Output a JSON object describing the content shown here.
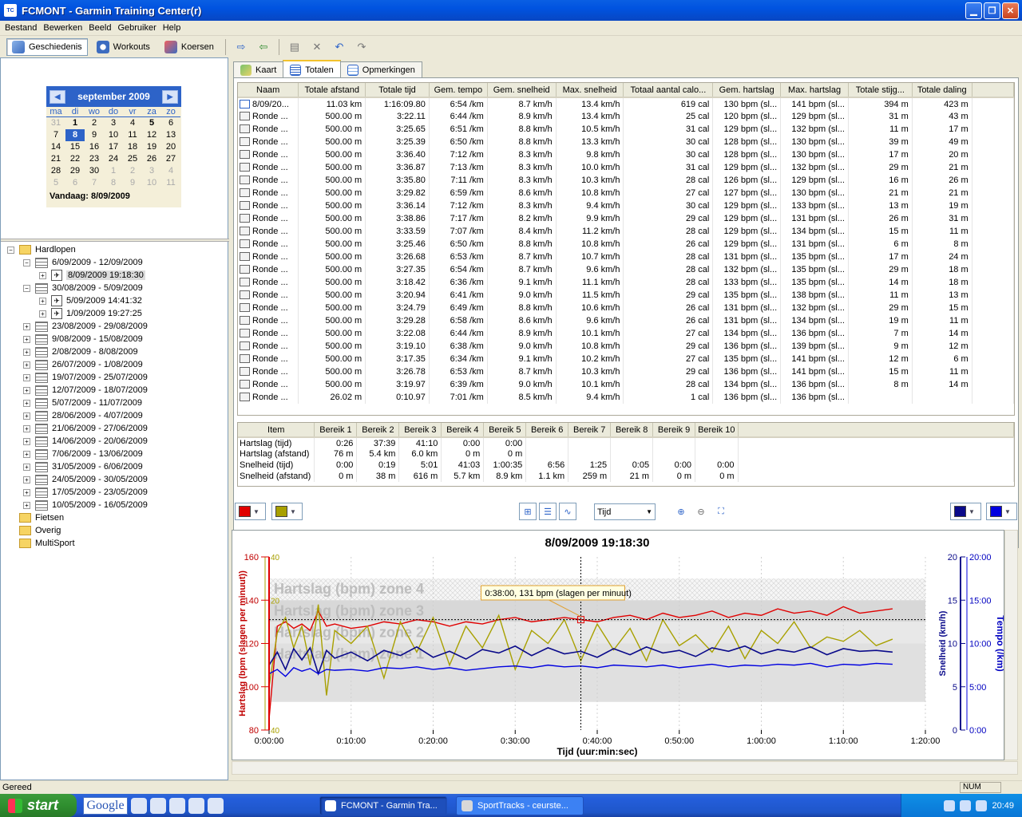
{
  "window": {
    "title": "FCMONT - Garmin Training Center(r)",
    "icon_text": "TC"
  },
  "menu": [
    "Bestand",
    "Bewerken",
    "Beeld",
    "Gebruiker",
    "Help"
  ],
  "toolbar": {
    "history": "Geschiedenis",
    "workouts": "Workouts",
    "courses": "Koersen"
  },
  "calendar": {
    "month": "september 2009",
    "dow": [
      "ma",
      "di",
      "wo",
      "do",
      "vr",
      "za",
      "zo"
    ],
    "rows": [
      [
        "31",
        "1",
        "2",
        "3",
        "4",
        "5",
        "6"
      ],
      [
        "7",
        "8",
        "9",
        "10",
        "11",
        "12",
        "13"
      ],
      [
        "14",
        "15",
        "16",
        "17",
        "18",
        "19",
        "20"
      ],
      [
        "21",
        "22",
        "23",
        "24",
        "25",
        "26",
        "27"
      ],
      [
        "28",
        "29",
        "30",
        "1",
        "2",
        "3",
        "4"
      ],
      [
        "5",
        "6",
        "7",
        "8",
        "9",
        "10",
        "11"
      ]
    ],
    "selected": "8",
    "today": "Vandaag: 8/09/2009"
  },
  "tree": {
    "root": "Hardlopen",
    "weeks_open": [
      {
        "label": "6/09/2009 - 12/09/2009",
        "acts": [
          "8/09/2009 19:18:30"
        ]
      },
      {
        "label": "30/08/2009 - 5/09/2009",
        "acts": [
          "5/09/2009 14:41:32",
          "1/09/2009 19:27:25"
        ]
      }
    ],
    "weeks_closed": [
      "23/08/2009 - 29/08/2009",
      "9/08/2009 - 15/08/2009",
      "2/08/2009 - 8/08/2009",
      "26/07/2009 - 1/08/2009",
      "19/07/2009 - 25/07/2009",
      "12/07/2009 - 18/07/2009",
      "5/07/2009 - 11/07/2009",
      "28/06/2009 - 4/07/2009",
      "21/06/2009 - 27/06/2009",
      "14/06/2009 - 20/06/2009",
      "7/06/2009 - 13/06/2009",
      "31/05/2009 - 6/06/2009",
      "24/05/2009 - 30/05/2009",
      "17/05/2009 - 23/05/2009",
      "10/05/2009 - 16/05/2009"
    ],
    "folders": [
      "Fietsen",
      "Overig",
      "MultiSport"
    ]
  },
  "tabs": [
    "Kaart",
    "Totalen",
    "Opmerkingen"
  ],
  "laps_table": {
    "headers": [
      "Naam",
      "Totale afstand",
      "Totale tijd",
      "Gem. tempo",
      "Gem. snelheid",
      "Max. snelheid",
      "Totaal aantal calo...",
      "Gem. hartslag",
      "Max. hartslag",
      "Totale stijg...",
      "Totale daling"
    ],
    "rows": [
      [
        "8/09/20...",
        "11.03 km",
        "1:16:09.80",
        "6:54 /km",
        "8.7 km/h",
        "13.4 km/h",
        "619 cal",
        "130 bpm (sl...",
        "141 bpm (sl...",
        "394 m",
        "423 m"
      ],
      [
        "Ronde ...",
        "500.00 m",
        "3:22.11",
        "6:44 /km",
        "8.9 km/h",
        "13.4 km/h",
        "25 cal",
        "120 bpm (sl...",
        "129 bpm (sl...",
        "31 m",
        "43 m"
      ],
      [
        "Ronde ...",
        "500.00 m",
        "3:25.65",
        "6:51 /km",
        "8.8 km/h",
        "10.5 km/h",
        "31 cal",
        "129 bpm (sl...",
        "132 bpm (sl...",
        "11 m",
        "17 m"
      ],
      [
        "Ronde ...",
        "500.00 m",
        "3:25.39",
        "6:50 /km",
        "8.8 km/h",
        "13.3 km/h",
        "30 cal",
        "128 bpm (sl...",
        "130 bpm (sl...",
        "39 m",
        "49 m"
      ],
      [
        "Ronde ...",
        "500.00 m",
        "3:36.40",
        "7:12 /km",
        "8.3 km/h",
        "9.8 km/h",
        "30 cal",
        "128 bpm (sl...",
        "130 bpm (sl...",
        "17 m",
        "20 m"
      ],
      [
        "Ronde ...",
        "500.00 m",
        "3:36.87",
        "7:13 /km",
        "8.3 km/h",
        "10.0 km/h",
        "31 cal",
        "129 bpm (sl...",
        "132 bpm (sl...",
        "29 m",
        "21 m"
      ],
      [
        "Ronde ...",
        "500.00 m",
        "3:35.80",
        "7:11 /km",
        "8.3 km/h",
        "10.3 km/h",
        "28 cal",
        "126 bpm (sl...",
        "129 bpm (sl...",
        "16 m",
        "26 m"
      ],
      [
        "Ronde ...",
        "500.00 m",
        "3:29.82",
        "6:59 /km",
        "8.6 km/h",
        "10.8 km/h",
        "27 cal",
        "127 bpm (sl...",
        "130 bpm (sl...",
        "21 m",
        "21 m"
      ],
      [
        "Ronde ...",
        "500.00 m",
        "3:36.14",
        "7:12 /km",
        "8.3 km/h",
        "9.4 km/h",
        "30 cal",
        "129 bpm (sl...",
        "133 bpm (sl...",
        "13 m",
        "19 m"
      ],
      [
        "Ronde ...",
        "500.00 m",
        "3:38.86",
        "7:17 /km",
        "8.2 km/h",
        "9.9 km/h",
        "29 cal",
        "129 bpm (sl...",
        "131 bpm (sl...",
        "26 m",
        "31 m"
      ],
      [
        "Ronde ...",
        "500.00 m",
        "3:33.59",
        "7:07 /km",
        "8.4 km/h",
        "11.2 km/h",
        "28 cal",
        "129 bpm (sl...",
        "134 bpm (sl...",
        "15 m",
        "11 m"
      ],
      [
        "Ronde ...",
        "500.00 m",
        "3:25.46",
        "6:50 /km",
        "8.8 km/h",
        "10.8 km/h",
        "26 cal",
        "129 bpm (sl...",
        "131 bpm (sl...",
        "6 m",
        "8 m"
      ],
      [
        "Ronde ...",
        "500.00 m",
        "3:26.68",
        "6:53 /km",
        "8.7 km/h",
        "10.7 km/h",
        "28 cal",
        "131 bpm (sl...",
        "135 bpm (sl...",
        "17 m",
        "24 m"
      ],
      [
        "Ronde ...",
        "500.00 m",
        "3:27.35",
        "6:54 /km",
        "8.7 km/h",
        "9.6 km/h",
        "28 cal",
        "132 bpm (sl...",
        "135 bpm (sl...",
        "29 m",
        "18 m"
      ],
      [
        "Ronde ...",
        "500.00 m",
        "3:18.42",
        "6:36 /km",
        "9.1 km/h",
        "11.1 km/h",
        "28 cal",
        "133 bpm (sl...",
        "135 bpm (sl...",
        "14 m",
        "18 m"
      ],
      [
        "Ronde ...",
        "500.00 m",
        "3:20.94",
        "6:41 /km",
        "9.0 km/h",
        "11.5 km/h",
        "29 cal",
        "135 bpm (sl...",
        "138 bpm (sl...",
        "11 m",
        "13 m"
      ],
      [
        "Ronde ...",
        "500.00 m",
        "3:24.79",
        "6:49 /km",
        "8.8 km/h",
        "10.6 km/h",
        "26 cal",
        "131 bpm (sl...",
        "132 bpm (sl...",
        "29 m",
        "15 m"
      ],
      [
        "Ronde ...",
        "500.00 m",
        "3:29.28",
        "6:58 /km",
        "8.6 km/h",
        "9.6 km/h",
        "26 cal",
        "131 bpm (sl...",
        "134 bpm (sl...",
        "19 m",
        "11 m"
      ],
      [
        "Ronde ...",
        "500.00 m",
        "3:22.08",
        "6:44 /km",
        "8.9 km/h",
        "10.1 km/h",
        "27 cal",
        "134 bpm (sl...",
        "136 bpm (sl...",
        "7 m",
        "14 m"
      ],
      [
        "Ronde ...",
        "500.00 m",
        "3:19.10",
        "6:38 /km",
        "9.0 km/h",
        "10.8 km/h",
        "29 cal",
        "136 bpm (sl...",
        "139 bpm (sl...",
        "9 m",
        "12 m"
      ],
      [
        "Ronde ...",
        "500.00 m",
        "3:17.35",
        "6:34 /km",
        "9.1 km/h",
        "10.2 km/h",
        "27 cal",
        "135 bpm (sl...",
        "141 bpm (sl...",
        "12 m",
        "6 m"
      ],
      [
        "Ronde ...",
        "500.00 m",
        "3:26.78",
        "6:53 /km",
        "8.7 km/h",
        "10.3 km/h",
        "29 cal",
        "136 bpm (sl...",
        "141 bpm (sl...",
        "15 m",
        "11 m"
      ],
      [
        "Ronde ...",
        "500.00 m",
        "3:19.97",
        "6:39 /km",
        "9.0 km/h",
        "10.1 km/h",
        "28 cal",
        "134 bpm (sl...",
        "136 bpm (sl...",
        "8 m",
        "14 m"
      ],
      [
        "Ronde ...",
        "26.02 m",
        "0:10.97",
        "7:01 /km",
        "8.5 km/h",
        "9.4 km/h",
        "1 cal",
        "136 bpm (sl...",
        "136 bpm (sl...",
        "",
        ""
      ]
    ]
  },
  "zones_table": {
    "headers": [
      "Item",
      "Bereik 1",
      "Bereik 2",
      "Bereik 3",
      "Bereik 4",
      "Bereik 5",
      "Bereik 6",
      "Bereik 7",
      "Bereik 8",
      "Bereik 9",
      "Bereik 10"
    ],
    "rows": [
      [
        "Hartslag (tijd)",
        "0:26",
        "37:39",
        "41:10",
        "0:00",
        "0:00",
        "",
        "",
        "",
        "",
        ""
      ],
      [
        "Hartslag (afstand)",
        "76 m",
        "5.4 km",
        "6.0 km",
        "0 m",
        "0 m",
        "",
        "",
        "",
        "",
        ""
      ],
      [
        "Snelheid (tijd)",
        "0:00",
        "0:19",
        "5:01",
        "41:03",
        "1:00:35",
        "6:56",
        "1:25",
        "0:05",
        "0:00",
        "0:00"
      ],
      [
        "Snelheid (afstand)",
        "0 m",
        "38 m",
        "616 m",
        "5.7 km",
        "8.9 km",
        "1.1 km",
        "259 m",
        "21 m",
        "0 m",
        "0 m"
      ]
    ]
  },
  "chart_controls": {
    "xaxis_select": "Tijd",
    "color_hr": "#e00000",
    "color_cad": "#a8a000",
    "color_speed": "#0a0a8a",
    "color_pace": "#0000e0"
  },
  "chart_data": {
    "type": "line",
    "title": "8/09/2009 19:18:30",
    "xlabel": "Tijd (uur:min:sec)",
    "x_ticks": [
      "0:00:00",
      "0:10:00",
      "0:20:00",
      "0:30:00",
      "0:40:00",
      "0:50:00",
      "1:00:00",
      "1:10:00",
      "1:20:00"
    ],
    "xlim_min": [
      0,
      80
    ],
    "ylabel_left": "Hartslag (bpm (slagen per minuut))",
    "ylim_left": [
      80,
      160
    ],
    "y_ticks_left": [
      "160",
      "140",
      "120",
      "100",
      "80"
    ],
    "y_ticks_left2": [
      "40",
      "20",
      "40"
    ],
    "ylabel_right_speed": "Snelheid (km/h)",
    "y_ticks_right_speed": [
      "20",
      "15",
      "10",
      "5",
      "0"
    ],
    "ylabel_right_pace": "Tempo (/km)",
    "y_ticks_right_pace": [
      "20:00",
      "15:00",
      "10:00",
      "5:00",
      "0:00"
    ],
    "zones": [
      {
        "label": "Hartslag (bpm) zone 4",
        "from": 140,
        "to": 150
      },
      {
        "label": "Hartslag (bpm) zone 3",
        "from": 130,
        "to": 140
      },
      {
        "label": "Hartslag (bpm) zone 2",
        "from": 120,
        "to": 130
      },
      {
        "label": "Hartslag (bpm) zone 1",
        "from": 93,
        "to": 120
      }
    ],
    "cursor": {
      "x": 38,
      "y": 131,
      "label": "0:38:00, 131 bpm (slagen per minuut)"
    },
    "series": [
      {
        "name": "Hartslag",
        "color": "#e00000",
        "axis": "bpm",
        "x": [
          0,
          1,
          2,
          3,
          4,
          5,
          6,
          7,
          8,
          10,
          12,
          14,
          16,
          18,
          20,
          22,
          24,
          26,
          28,
          30,
          32,
          34,
          36,
          38,
          40,
          42,
          44,
          46,
          48,
          50,
          52,
          54,
          56,
          58,
          60,
          62,
          64,
          66,
          68,
          70,
          72,
          74,
          76
        ],
        "y": [
          85,
          128,
          130,
          127,
          129,
          126,
          135,
          128,
          129,
          127,
          128,
          130,
          129,
          131,
          130,
          128,
          130,
          129,
          131,
          132,
          130,
          131,
          132,
          131,
          130,
          132,
          133,
          131,
          134,
          132,
          133,
          135,
          132,
          134,
          133,
          136,
          134,
          135,
          133,
          137,
          134,
          135,
          136
        ]
      },
      {
        "name": "Cadans",
        "color": "#a8a000",
        "axis": "bpm",
        "x": [
          0,
          1,
          2,
          3,
          4,
          5,
          6,
          7,
          8,
          10,
          12,
          14,
          16,
          18,
          20,
          22,
          24,
          26,
          28,
          30,
          32,
          34,
          36,
          38,
          40,
          42,
          44,
          46,
          48,
          50,
          52,
          54,
          56,
          58,
          60,
          62,
          64,
          66,
          68,
          70,
          72,
          74,
          76
        ],
        "y": [
          100,
          125,
          132,
          118,
          128,
          110,
          138,
          96,
          126,
          120,
          128,
          104,
          130,
          116,
          132,
          110,
          128,
          118,
          133,
          108,
          126,
          120,
          131,
          112,
          129,
          117,
          127,
          112,
          131,
          119,
          124,
          116,
          128,
          113,
          126,
          120,
          130,
          118,
          123,
          121,
          126,
          119,
          122
        ]
      },
      {
        "name": "Snelheid",
        "color": "#0a0a8a",
        "axis": "kmh",
        "x": [
          0,
          1,
          2,
          3,
          4,
          5,
          6,
          7,
          8,
          10,
          12,
          14,
          16,
          18,
          20,
          22,
          24,
          26,
          28,
          30,
          32,
          34,
          36,
          38,
          40,
          42,
          44,
          46,
          48,
          50,
          52,
          54,
          56,
          58,
          60,
          62,
          64,
          66,
          68,
          70,
          72,
          74,
          76
        ],
        "y": [
          7.5,
          9.0,
          7.0,
          9.4,
          8.1,
          9.5,
          6.5,
          9.2,
          8.3,
          9.0,
          8.0,
          9.2,
          8.6,
          9.6,
          8.4,
          9.1,
          8.2,
          9.3,
          8.9,
          9.7,
          8.6,
          9.5,
          8.8,
          9.1,
          8.4,
          9.4,
          8.7,
          9.6,
          8.9,
          9.2,
          8.5,
          9.5,
          9.1,
          9.7,
          8.8,
          9.3,
          9.0,
          9.6,
          8.7,
          9.4,
          9.1,
          9.2,
          9.0
        ]
      },
      {
        "name": "Tempo",
        "color": "#0000e0",
        "axis": "kmh",
        "x": [
          0,
          1,
          2,
          3,
          4,
          5,
          6,
          7,
          8,
          10,
          12,
          14,
          16,
          18,
          20,
          22,
          24,
          26,
          28,
          30,
          32,
          34,
          36,
          38,
          40,
          42,
          44,
          46,
          48,
          50,
          52,
          54,
          56,
          58,
          60,
          62,
          64,
          66,
          68,
          70,
          72,
          74,
          76
        ],
        "y": [
          6.5,
          7.0,
          6.2,
          7.2,
          6.8,
          7.1,
          6.5,
          7.0,
          6.9,
          7.0,
          6.8,
          7.2,
          7.1,
          7.3,
          7.0,
          7.2,
          6.9,
          7.1,
          7.3,
          7.4,
          7.2,
          7.5,
          7.3,
          7.4,
          7.2,
          7.5,
          7.4,
          7.3,
          7.5,
          7.2,
          7.4,
          7.6,
          7.3,
          7.5,
          7.4,
          7.6,
          7.5,
          7.7,
          7.3,
          7.6,
          7.5,
          7.7,
          7.6
        ]
      }
    ]
  },
  "status": {
    "left": "Gereed",
    "num": "NUM"
  },
  "taskbar": {
    "start": "start",
    "google": "Google",
    "task1": "FCMONT - Garmin Tra...",
    "task2": "SportTracks - ceurste...",
    "clock": "20:49"
  }
}
